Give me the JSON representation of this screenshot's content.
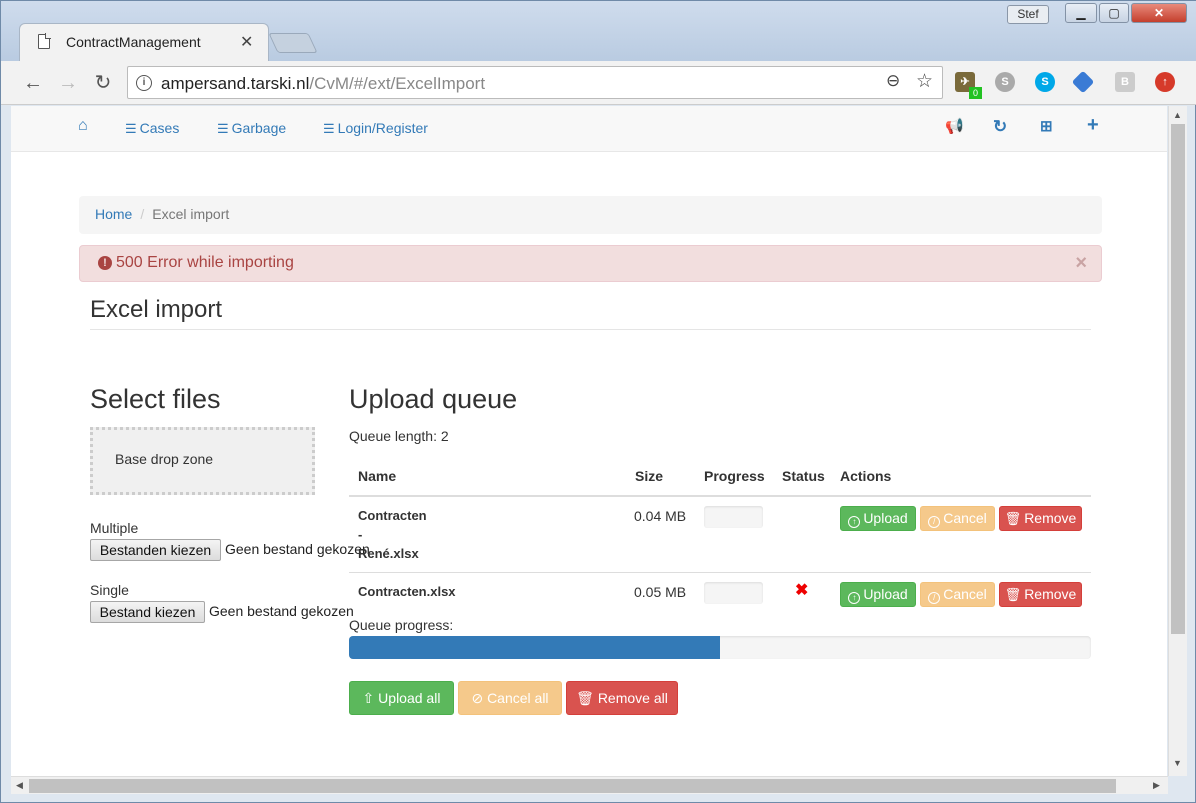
{
  "browser": {
    "tab_title": "ContractManagement",
    "user_badge": "Stef",
    "url_host": "ampersand.tarski.nl",
    "url_path": "/CvM/#/ext/ExcelImport",
    "extension_badge_count": "0"
  },
  "navbar": {
    "items": [
      {
        "label": "Cases"
      },
      {
        "label": "Garbage"
      },
      {
        "label": "Login/Register"
      }
    ]
  },
  "breadcrumb": {
    "home": "Home",
    "separator": "/",
    "current": "Excel import"
  },
  "alert": {
    "message": "500 Error while importing",
    "close": "×"
  },
  "page_title": "Excel import",
  "select_files": {
    "heading": "Select files",
    "drop_zone": "Base drop zone",
    "multiple_label": "Multiple",
    "multiple_button": "Bestanden kiezen",
    "multiple_text": "Geen bestand gekozen",
    "single_label": "Single",
    "single_button": "Bestand kiezen",
    "single_text": "Geen bestand gekozen"
  },
  "upload_queue": {
    "heading": "Upload queue",
    "queue_length": "Queue length: 2",
    "columns": {
      "name": "Name",
      "size": "Size",
      "progress": "Progress",
      "status": "Status",
      "actions": "Actions"
    },
    "rows": [
      {
        "name_lines": [
          "Contracten",
          "-",
          "René.xlsx"
        ],
        "size": "0.04 MB",
        "progress": 0,
        "status": ""
      },
      {
        "name_lines": [
          "Contracten.xlsx"
        ],
        "size": "0.05 MB",
        "progress": 0,
        "status": "✖"
      }
    ],
    "row_buttons": {
      "upload": "Upload",
      "cancel": "Cancel",
      "remove": "Remove"
    },
    "queue_progress_label": "Queue progress:",
    "queue_progress_value": 0.5,
    "buttons": {
      "upload_all": "Upload all",
      "cancel_all": "Cancel all",
      "remove_all": "Remove all"
    }
  },
  "colors": {
    "primary": "#337ab7",
    "success": "#5cb85c",
    "warning": "#f0ad4e",
    "danger": "#d9534f",
    "alert_bg": "#f2dede",
    "alert_text": "#a94442"
  }
}
